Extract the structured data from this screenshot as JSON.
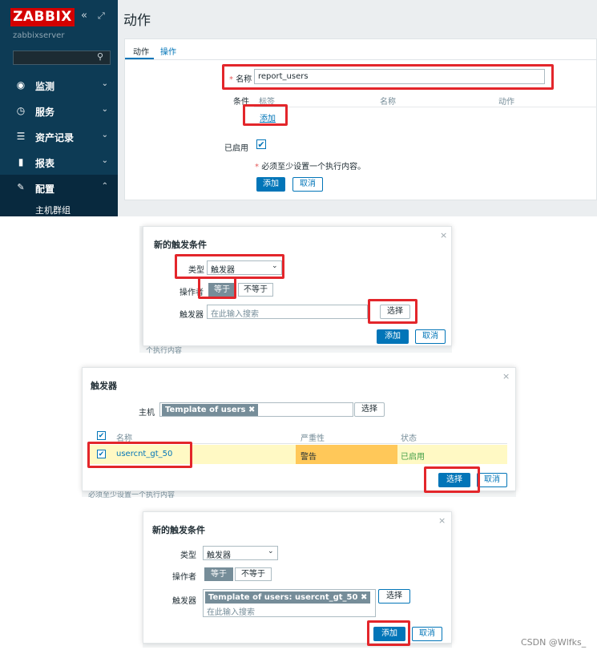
{
  "panel1": {
    "logo": "ZABBIX",
    "collapse_glyph": "«",
    "expand_glyph": "⤢",
    "server": "zabbixserver",
    "search_icon": "🔍",
    "nav": [
      {
        "label": "监测",
        "icon": "eye-icon",
        "glyph": "◉",
        "chevron": "⌄"
      },
      {
        "label": "服务",
        "icon": "clock-icon",
        "glyph": "◷",
        "chevron": "⌄"
      },
      {
        "label": "资产记录",
        "icon": "list-icon",
        "glyph": "☰",
        "chevron": "⌄"
      },
      {
        "label": "报表",
        "icon": "chart-icon",
        "glyph": "▮",
        "chevron": "⌄"
      },
      {
        "label": "配置",
        "icon": "wrench-icon",
        "glyph": "🔧",
        "chevron": "⌃"
      }
    ],
    "sub_item": "主机群组",
    "page_title": "动作",
    "tabs": [
      "动作",
      "操作"
    ],
    "name_label": "名称",
    "name_value": "report_users",
    "cond_label": "条件",
    "cond_headers": [
      "标签",
      "名称",
      "动作"
    ],
    "add_link": "添加",
    "enabled_label": "已启用",
    "check_glyph": "✔",
    "warning": "必须至少设置一个执行内容。",
    "btn_add": "添加",
    "btn_cancel": "取消",
    "required_star": "*"
  },
  "dialog1": {
    "title": "新的触发条件",
    "close": "×",
    "type_label": "类型",
    "type_value": "触发器",
    "operator_label": "操作者",
    "op_equal": "等于",
    "op_not_equal": "不等于",
    "trigger_label": "触发器",
    "trigger_placeholder": "在此输入搜索",
    "select_btn": "选择",
    "add_btn": "添加",
    "cancel_btn": "取消",
    "bg_text": "个执行内容"
  },
  "dialog2": {
    "title": "触发器",
    "close": "×",
    "host_label": "主机",
    "host_chip": "Template of users",
    "chip_x": "✖",
    "select_btn": "选择",
    "col_name": "名称",
    "col_severity": "严重性",
    "col_status": "状态",
    "row": {
      "name": "usercnt_gt_50",
      "severity": "警告",
      "status": "已启用"
    },
    "ok_btn": "选择",
    "cancel_btn": "取消",
    "bg_text": "必须至少设置一个执行内容"
  },
  "dialog3": {
    "title": "新的触发条件",
    "close": "×",
    "type_label": "类型",
    "type_value": "触发器",
    "operator_label": "操作者",
    "op_equal": "等于",
    "op_not_equal": "不等于",
    "trigger_label": "触发器",
    "trigger_chip": "Template of users: usercnt_gt_50",
    "chip_x": "✖",
    "trigger_placeholder": "在此输入搜索",
    "select_btn": "选择",
    "add_btn": "添加",
    "cancel_btn": "取消"
  },
  "watermark": "CSDN @Wlfks_",
  "colors": {
    "zabbix_red": "#d40000",
    "sidebar": "#0d3b55",
    "primary": "#0275b8",
    "highlight_red": "#e3262b",
    "warning": "#ffc859",
    "row_highlight": "#fff9c4",
    "enabled": "#429e47"
  }
}
